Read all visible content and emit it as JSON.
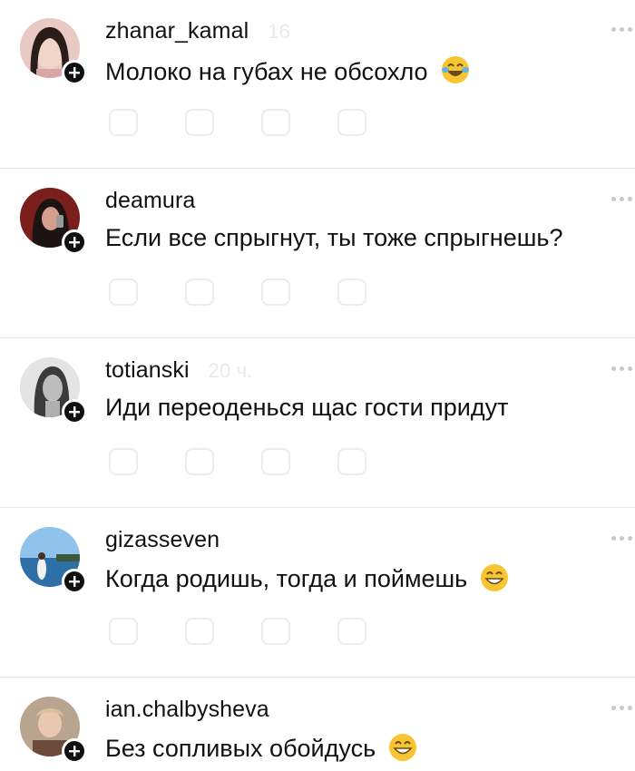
{
  "posts": [
    {
      "username": "zhanar_kamal",
      "time": "16",
      "message": "Молоко на губах не обсохло",
      "emoji": "joy-emoji"
    },
    {
      "username": "deamura",
      "time": "",
      "message": "Если все спрыгнут, ты тоже спрыгнешь?",
      "emoji": ""
    },
    {
      "username": "totianski",
      "time": "20 ч.",
      "message": "Иди переоденься щас гости придут",
      "emoji": ""
    },
    {
      "username": "gizasseven",
      "time": "",
      "message": "Когда родишь, тогда и поймешь",
      "emoji": "grin-emoji"
    },
    {
      "username": "ian.chalbysheva",
      "time": "",
      "message": "Без сопливых обойдусь",
      "emoji": "grin-emoji"
    }
  ],
  "icons": {
    "follow": "plus-icon",
    "more": "more-dots-icon"
  },
  "colors": {
    "text": "#111111",
    "divider": "#e6e6e6",
    "plus_badge": "#111111",
    "emoji_yellow": "#f7c531"
  }
}
